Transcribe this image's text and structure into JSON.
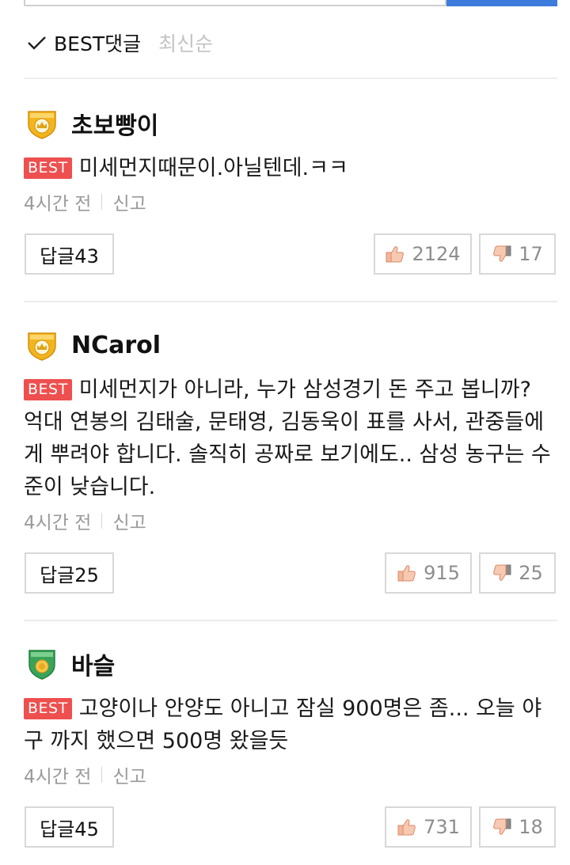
{
  "sort": {
    "best_label": "BEST댓글",
    "latest_label": "최신순"
  },
  "best_badge_text": "BEST",
  "comments": [
    {
      "author": "초보빵이",
      "badge": "master-crown-icon",
      "text": "미세먼지때문이.아닐텐데.ㅋㅋ",
      "time": "4시간 전",
      "report": "신고",
      "reply": "답글43",
      "likes": "2124",
      "dislikes": "17"
    },
    {
      "author": "NCarol",
      "badge": "master-crown-icon",
      "text": "미세먼지가 아니라, 누가 삼성경기 돈 주고 봅니까? 억대 연봉의 김태술, 문태영, 김동욱이 표를 사서, 관중들에게 뿌려야 합니다. 솔직히 공짜로 보기에도.. 삼성 농구는 수준이 낮습니다.",
      "time": "4시간 전",
      "report": "신고",
      "reply": "답글25",
      "likes": "915",
      "dislikes": "25"
    },
    {
      "author": "바슬",
      "badge": "amateur-shield-icon",
      "text": "고양이나 안양도 아니고 잠실 900명은 좀... 오늘 야구 까지 했으면 500명 왔을듯",
      "time": "4시간 전",
      "report": "신고",
      "reply": "답글45",
      "likes": "731",
      "dislikes": "18"
    }
  ],
  "colors": {
    "best_badge": "#ee4f4f",
    "accent_blue": "#3d7bdc",
    "master_gold": "#f2b51d",
    "amateur_green": "#3aa35a"
  }
}
